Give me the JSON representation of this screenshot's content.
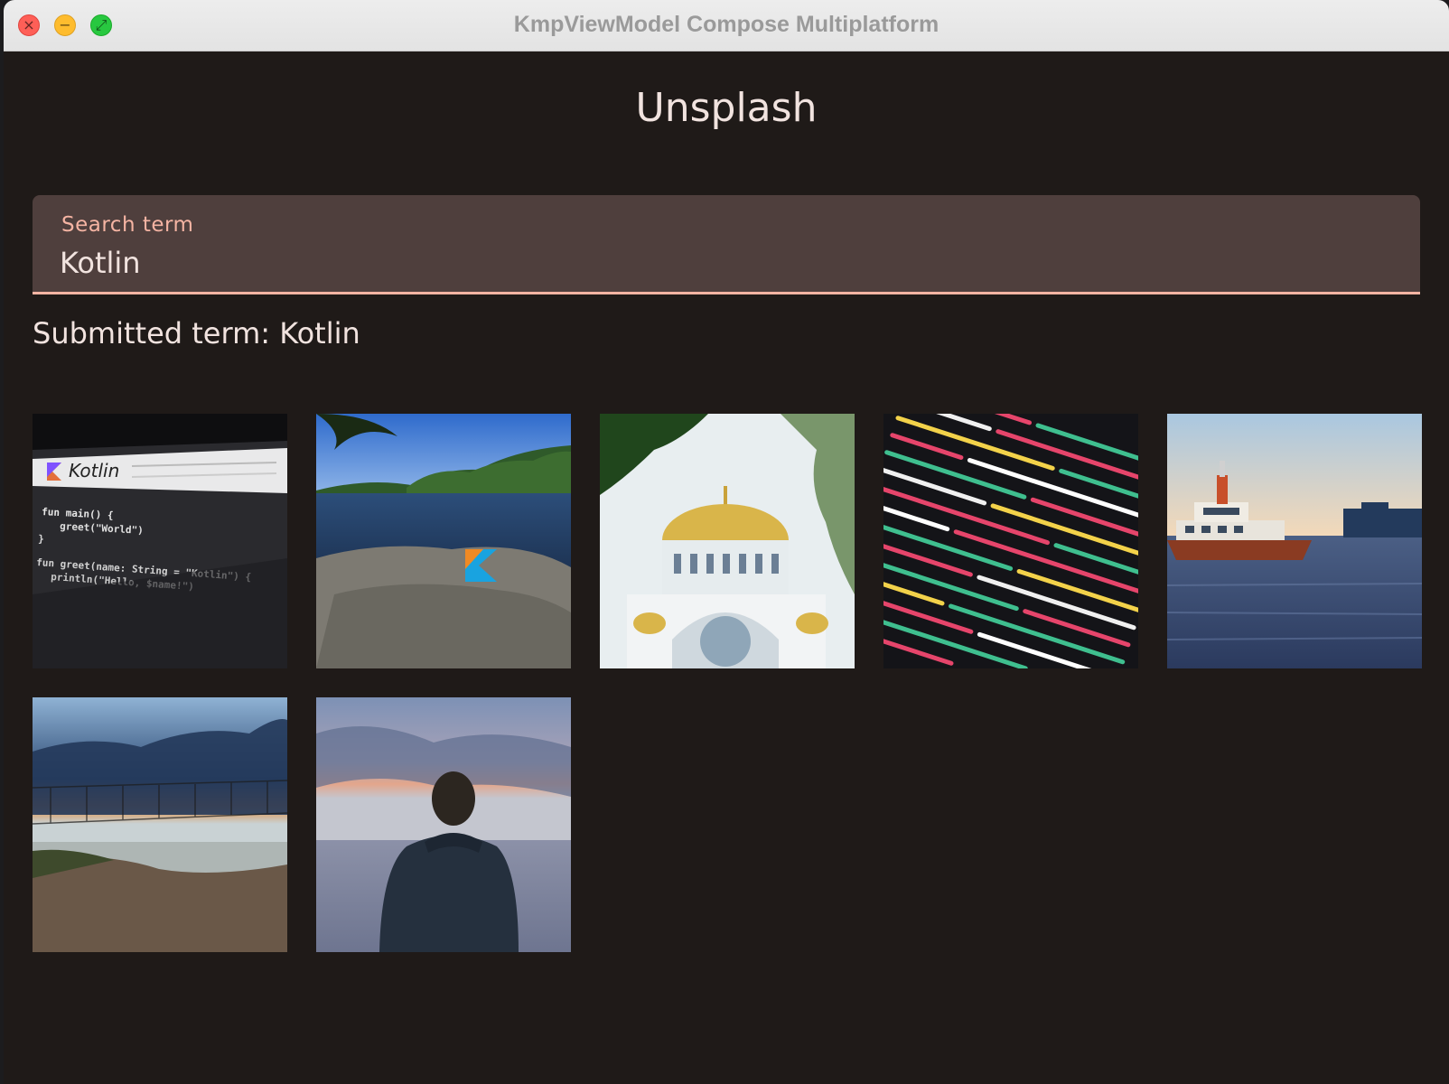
{
  "window": {
    "title": "KmpViewModel Compose Multiplatform"
  },
  "app": {
    "heading": "Unsplash",
    "search": {
      "label": "Search term",
      "value": "Kotlin"
    },
    "submitted": "Submitted term: Kotlin"
  },
  "photo_code": {
    "kotlin_title": "Kotlin",
    "line1": "fun main() {",
    "line2": "greet(\"World\")",
    "line3": "}",
    "line4": "fun greet(name: String = \"Kotlin\") {",
    "line5": "println(\"Hello, $name!\")"
  },
  "colors": {
    "accent": "#f5b4a3",
    "background": "#1f1a18",
    "field": "#4f3f3d"
  }
}
